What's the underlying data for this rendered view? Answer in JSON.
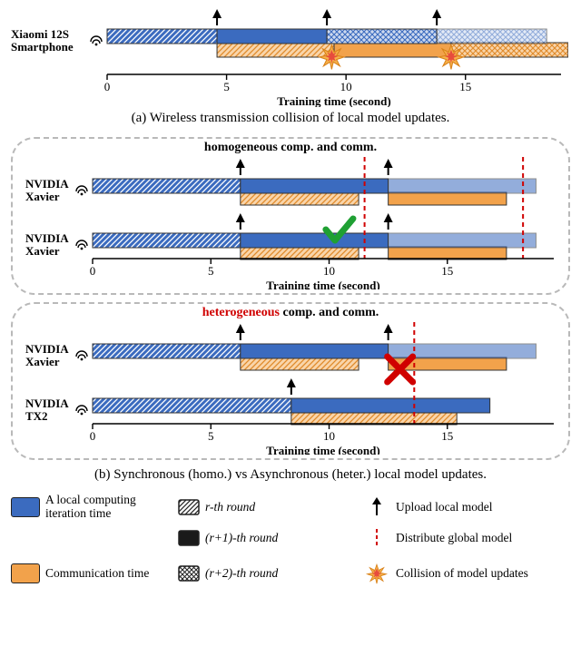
{
  "chart_data": [
    {
      "type": "bar",
      "id": "panel_a",
      "caption": "(a)  Wireless transmission collision of local model updates.",
      "xlabel": "Training time (second)",
      "xlim": [
        0,
        19
      ],
      "xticks": [
        0,
        5,
        10,
        15
      ],
      "rows": [
        "Xiaomi 12S\nSmartphone"
      ],
      "segments": [
        {
          "row": 0,
          "start": 0,
          "end": 4.6,
          "kind": "compute",
          "round": 0
        },
        {
          "row": 0,
          "start": 4.6,
          "end": 9.2,
          "kind": "compute",
          "round": 1
        },
        {
          "row": 0,
          "start": 9.2,
          "end": 13.8,
          "kind": "compute",
          "round": 2
        },
        {
          "row": 0,
          "start": 13.8,
          "end": 18.4,
          "kind": "compute",
          "round": 2,
          "faded": true
        },
        {
          "row": 0,
          "start": 4.6,
          "end": 9.5,
          "kind": "comm",
          "round": 0,
          "sub": "below"
        },
        {
          "row": 0,
          "start": 9.5,
          "end": 14.4,
          "kind": "comm",
          "round": 1,
          "sub": "below"
        },
        {
          "row": 0,
          "start": 14.4,
          "end": 19.3,
          "kind": "comm",
          "round": 2,
          "sub": "below"
        }
      ],
      "upload_markers": [
        {
          "row": 0,
          "t": 4.6
        },
        {
          "row": 0,
          "t": 9.2
        },
        {
          "row": 0,
          "t": 13.8
        }
      ],
      "collisions": [
        {
          "row": 0,
          "t": 9.4
        },
        {
          "row": 0,
          "t": 14.4
        }
      ]
    },
    {
      "type": "bar",
      "id": "panel_b1",
      "title": "homogeneous comp. and comm.",
      "xlabel": "Training time (second)",
      "xlim": [
        0,
        19.5
      ],
      "xticks": [
        0,
        5,
        10,
        15
      ],
      "rows": [
        "NVIDIA\nXavier",
        "NVIDIA\nXavier"
      ],
      "segments": [
        {
          "row": 0,
          "start": 0,
          "end": 6.25,
          "kind": "compute",
          "round": 0
        },
        {
          "row": 0,
          "start": 6.25,
          "end": 12.5,
          "kind": "compute",
          "round": 1
        },
        {
          "row": 0,
          "start": 12.5,
          "end": 18.75,
          "kind": "compute",
          "round": 1,
          "faded": true
        },
        {
          "row": 0,
          "start": 6.25,
          "end": 11.25,
          "kind": "comm",
          "round": 0,
          "sub": "below"
        },
        {
          "row": 0,
          "start": 12.5,
          "end": 17.5,
          "kind": "comm",
          "round": 1,
          "sub": "below"
        },
        {
          "row": 1,
          "start": 0,
          "end": 6.25,
          "kind": "compute",
          "round": 0
        },
        {
          "row": 1,
          "start": 6.25,
          "end": 12.5,
          "kind": "compute",
          "round": 1
        },
        {
          "row": 1,
          "start": 12.5,
          "end": 18.75,
          "kind": "compute",
          "round": 1,
          "faded": true
        },
        {
          "row": 1,
          "start": 6.25,
          "end": 11.25,
          "kind": "comm",
          "round": 0,
          "sub": "below"
        },
        {
          "row": 1,
          "start": 12.5,
          "end": 17.5,
          "kind": "comm",
          "round": 1,
          "sub": "below"
        }
      ],
      "upload_markers": [
        {
          "row": 0,
          "t": 6.25
        },
        {
          "row": 0,
          "t": 12.5
        },
        {
          "row": 1,
          "t": 6.25
        },
        {
          "row": 1,
          "t": 12.5
        }
      ],
      "distribute_lines": [
        11.5,
        18.2
      ],
      "annotation": {
        "type": "check",
        "t": 10.4,
        "row": 1,
        "y_off": -12
      }
    },
    {
      "type": "bar",
      "id": "panel_b2",
      "title_html": "heterogeneous comp. and comm.",
      "title_het_word": "heterogeneous",
      "xlabel": "Training time (second)",
      "xlim": [
        0,
        19.5
      ],
      "xticks": [
        0,
        5,
        10,
        15
      ],
      "rows": [
        "NVIDIA\nXavier",
        "NVIDIA\nTX2"
      ],
      "segments": [
        {
          "row": 0,
          "start": 0,
          "end": 6.25,
          "kind": "compute",
          "round": 0
        },
        {
          "row": 0,
          "start": 6.25,
          "end": 12.5,
          "kind": "compute",
          "round": 1
        },
        {
          "row": 0,
          "start": 12.5,
          "end": 18.75,
          "kind": "compute",
          "round": 1,
          "faded": true
        },
        {
          "row": 0,
          "start": 6.25,
          "end": 11.25,
          "kind": "comm",
          "round": 0,
          "sub": "below"
        },
        {
          "row": 0,
          "start": 12.5,
          "end": 17.5,
          "kind": "comm",
          "round": 1,
          "sub": "below"
        },
        {
          "row": 1,
          "start": 0,
          "end": 8.4,
          "kind": "compute",
          "round": 0
        },
        {
          "row": 1,
          "start": 8.4,
          "end": 16.8,
          "kind": "compute",
          "round": 1
        },
        {
          "row": 1,
          "start": 8.4,
          "end": 15.4,
          "kind": "comm",
          "round": 0,
          "sub": "below"
        }
      ],
      "upload_markers": [
        {
          "row": 0,
          "t": 6.25
        },
        {
          "row": 0,
          "t": 12.5
        },
        {
          "row": 1,
          "t": 8.4
        }
      ],
      "distribute_lines": [
        13.6
      ],
      "annotation": {
        "type": "cross",
        "t": 13.0,
        "row": 0,
        "y_off": 20
      }
    }
  ],
  "caption_b": "(b)  Synchronous (homo.) vs Asynchronous (heter.) local model updates.",
  "legend": {
    "compute": "A local computing iteration time",
    "comm": "Communication time",
    "r0": "r-th round",
    "r1": "(r+1)-th round",
    "r2": "(r+2)-th round",
    "upload": "Upload local model",
    "distribute": "Distribute global model",
    "collision": "Collision of model updates"
  },
  "colors": {
    "blue": "#3b6bbf",
    "blue_light": "#9db7e0",
    "orange": "#f2a24b",
    "stroke": "#1a1a1a"
  }
}
